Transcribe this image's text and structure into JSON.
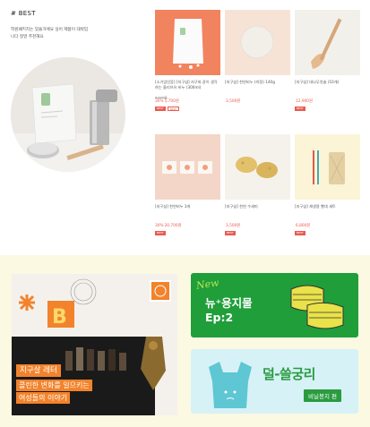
{
  "best": {
    "heading": "# BEST",
    "description": "학원패키지는 있을거에요 싶어 제품이 대박입니다 정말 추천해요"
  },
  "products": [
    {
      "name": "[소기업인증] [지구샵] 지구와 같이 생각하는 올리브유 비누 (300ml)",
      "orig": "9,900원",
      "disc": "30%",
      "price": "5,700원",
      "badges": [
        "BEST",
        "NEW"
      ]
    },
    {
      "name": "[지구샵] 천연비누 (미정) 140g",
      "orig": "",
      "disc": "",
      "price": "3,500원",
      "badges": []
    },
    {
      "name": "[지구샵] 대나무칫솔 (10개)",
      "orig": "",
      "disc": "",
      "price": "12,900원",
      "badges": [
        "BEST"
      ]
    },
    {
      "name": "[지구샵] 천연비누 3개",
      "orig": "",
      "disc": "30%",
      "price": "20,700원",
      "badges": [
        "BEST"
      ]
    },
    {
      "name": "[지구샵] 천연 수세미",
      "orig": "",
      "disc": "",
      "price": "3,500원",
      "badges": [
        "BEST"
      ]
    },
    {
      "name": "[지구샵] 재생용 빨대 세트",
      "orig": "",
      "disc": "",
      "price": "6,800원",
      "badges": [
        "BEST"
      ]
    }
  ],
  "letter": {
    "title": "지구살 레터",
    "line1": "콜린한 변화를 일으키는",
    "line2": "여성들의 이야기"
  },
  "banner1": {
    "script": "New",
    "title1": "뉴⁺용지물",
    "title2": "Ep:2"
  },
  "banner2": {
    "title": "덜-쓸궁리",
    "sub": "비닐봉지 편"
  },
  "colors": {
    "accent": "#e85a4f",
    "orange": "#f2832c",
    "green": "#1f9e3a",
    "cream": "#fbf9e2"
  }
}
